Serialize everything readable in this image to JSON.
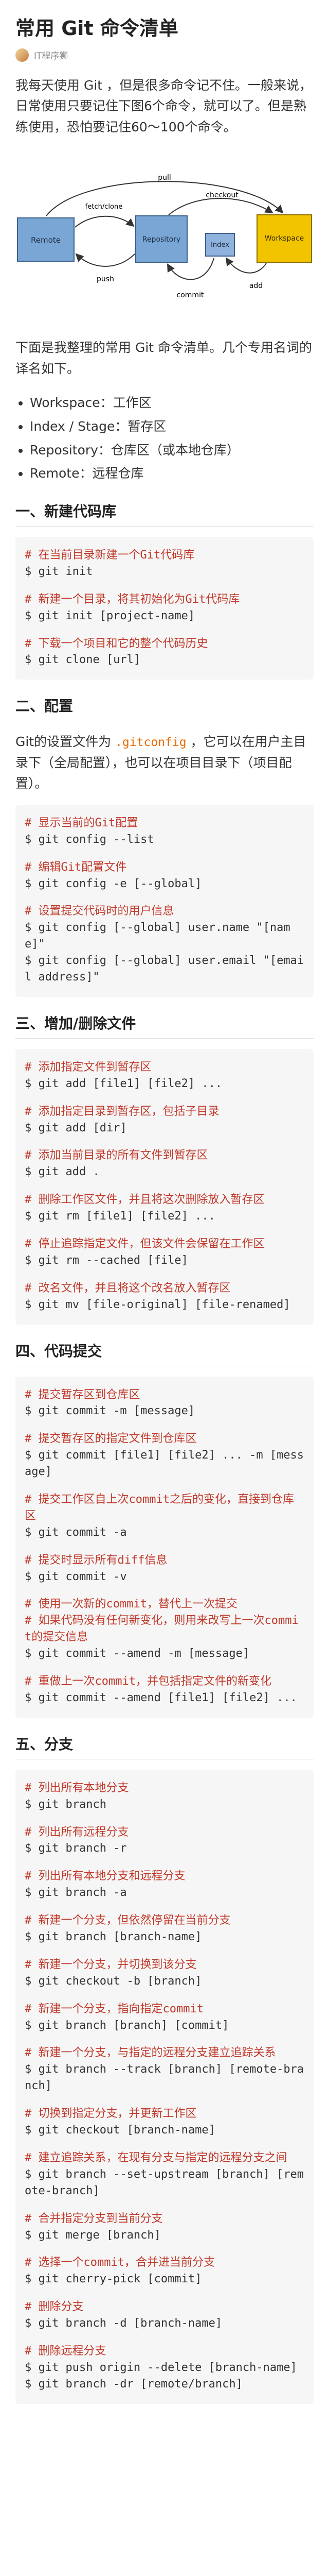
{
  "article": {
    "title": "常用 Git 命令清单",
    "author": "IT程序狮",
    "intro": "我每天使用 Git ，但是很多命令记不住。一般来说，日常使用只要记住下图6个命令，就可以了。但是熟练使用，恐怕要记住60～100个命令。",
    "diagram": {
      "nodes": [
        "Remote",
        "Repository",
        "Index",
        "Workspace"
      ],
      "arrows": [
        "fetch/clone",
        "push",
        "pull",
        "checkout",
        "add",
        "commit"
      ]
    },
    "terms_intro": "下面是我整理的常用 Git 命令清单。几个专用名词的译名如下。",
    "terms": [
      "Workspace：工作区",
      "Index / Stage：暂存区",
      "Repository：仓库区（或本地仓库）",
      "Remote：远程仓库"
    ]
  },
  "sections": [
    {
      "heading": "一、新建代码库",
      "blocks": [
        {
          "lines": [
            {
              "c": "# 在当前目录新建一个Git代码库"
            },
            {
              "k": "$ git init"
            },
            {
              "s": true
            },
            {
              "c": "# 新建一个目录，将其初始化为Git代码库"
            },
            {
              "k": "$ git init [project-name]"
            },
            {
              "s": true
            },
            {
              "c": "# 下载一个项目和它的整个代码历史"
            },
            {
              "k": "$ git clone [url]"
            }
          ]
        }
      ]
    },
    {
      "heading": "二、配置",
      "text": [
        "Git的设置文件为 ",
        ".gitconfig",
        " ，它可以在用户主目录下（全局配置），也可以在项目目录下（项目配置）。"
      ],
      "blocks": [
        {
          "lines": [
            {
              "c": "# 显示当前的Git配置"
            },
            {
              "k": "$ git config --list"
            },
            {
              "s": true
            },
            {
              "c": "# 编辑Git配置文件"
            },
            {
              "k": "$ git config -e [--global]"
            },
            {
              "s": true
            },
            {
              "c": "# 设置提交代码时的用户信息"
            },
            {
              "k": "$ git config [--global] user.name \"[name]\""
            },
            {
              "k": "$ git config [--global] user.email \"[email address]\""
            }
          ]
        }
      ]
    },
    {
      "heading": "三、增加/删除文件",
      "blocks": [
        {
          "lines": [
            {
              "c": "# 添加指定文件到暂存区"
            },
            {
              "k": "$ git add [file1] [file2] ..."
            },
            {
              "s": true
            },
            {
              "c": "# 添加指定目录到暂存区，包括子目录"
            },
            {
              "k": "$ git add [dir]"
            },
            {
              "s": true
            },
            {
              "c": "# 添加当前目录的所有文件到暂存区"
            },
            {
              "k": "$ git add ."
            },
            {
              "s": true
            },
            {
              "c": "# 删除工作区文件，并且将这次删除放入暂存区"
            },
            {
              "k": "$ git rm [file1] [file2] ..."
            },
            {
              "s": true
            },
            {
              "c": "# 停止追踪指定文件，但该文件会保留在工作区"
            },
            {
              "k": "$ git rm --cached [file]"
            },
            {
              "s": true
            },
            {
              "c": "# 改名文件，并且将这个改名放入暂存区"
            },
            {
              "k": "$ git mv [file-original] [file-renamed]"
            }
          ]
        }
      ]
    },
    {
      "heading": "四、代码提交",
      "blocks": [
        {
          "lines": [
            {
              "c": "# 提交暂存区到仓库区"
            },
            {
              "k": "$ git commit -m [message]"
            },
            {
              "s": true
            },
            {
              "c": "# 提交暂存区的指定文件到仓库区"
            },
            {
              "k": "$ git commit [file1] [file2] ... -m [message]"
            },
            {
              "s": true
            },
            {
              "c": "# 提交工作区自上次commit之后的变化，直接到仓库区"
            },
            {
              "k": "$ git commit -a"
            },
            {
              "s": true
            },
            {
              "c": "# 提交时显示所有diff信息"
            },
            {
              "k": "$ git commit -v"
            },
            {
              "s": true
            },
            {
              "c": "# 使用一次新的commit，替代上一次提交"
            },
            {
              "c": "# 如果代码没有任何新变化，则用来改写上一次commit的提交信息"
            },
            {
              "k": "$ git commit --amend -m [message]"
            },
            {
              "s": true
            },
            {
              "c": "# 重做上一次commit，并包括指定文件的新变化"
            },
            {
              "k": "$ git commit --amend [file1] [file2] ..."
            }
          ]
        }
      ]
    },
    {
      "heading": "五、分支",
      "blocks": [
        {
          "lines": [
            {
              "c": "# 列出所有本地分支"
            },
            {
              "k": "$ git branch"
            },
            {
              "s": true
            },
            {
              "c": "# 列出所有远程分支"
            },
            {
              "k": "$ git branch -r"
            },
            {
              "s": true
            },
            {
              "c": "# 列出所有本地分支和远程分支"
            },
            {
              "k": "$ git branch -a"
            },
            {
              "s": true
            },
            {
              "c": "# 新建一个分支，但依然停留在当前分支"
            },
            {
              "k": "$ git branch [branch-name]"
            },
            {
              "s": true
            },
            {
              "c": "# 新建一个分支，并切换到该分支"
            },
            {
              "k": "$ git checkout -b [branch]"
            },
            {
              "s": true
            },
            {
              "c": "# 新建一个分支，指向指定commit"
            },
            {
              "k": "$ git branch [branch] [commit]"
            },
            {
              "s": true
            },
            {
              "c": "# 新建一个分支，与指定的远程分支建立追踪关系"
            },
            {
              "k": "$ git branch --track [branch] [remote-branch]"
            },
            {
              "s": true
            },
            {
              "c": "# 切换到指定分支，并更新工作区"
            },
            {
              "k": "$ git checkout [branch-name]"
            },
            {
              "s": true
            },
            {
              "c": "# 建立追踪关系，在现有分支与指定的远程分支之间"
            },
            {
              "k": "$ git branch --set-upstream [branch] [remote-branch]"
            },
            {
              "s": true
            },
            {
              "c": "# 合并指定分支到当前分支"
            },
            {
              "k": "$ git merge [branch]"
            },
            {
              "s": true
            },
            {
              "c": "# 选择一个commit，合并进当前分支"
            },
            {
              "k": "$ git cherry-pick [commit]"
            },
            {
              "s": true
            },
            {
              "c": "# 删除分支"
            },
            {
              "k": "$ git branch -d [branch-name]"
            },
            {
              "s": true
            },
            {
              "c": "# 删除远程分支"
            },
            {
              "k": "$ git push origin --delete [branch-name]"
            },
            {
              "k": "$ git branch -dr [remote/branch]"
            }
          ]
        }
      ]
    }
  ]
}
